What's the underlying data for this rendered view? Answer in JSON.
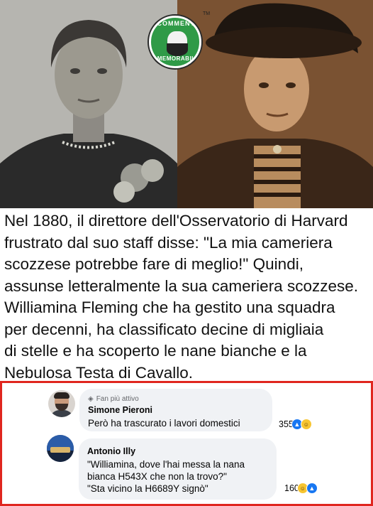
{
  "brand": {
    "badge_top": "COMMENTI",
    "badge_bottom": "MEMORABILI",
    "trademark": "TM",
    "color": "#2f9a47"
  },
  "caption": {
    "lines": [
      "Nel 1880, il direttore dell'Osservatorio di Harvard",
      "frustrato dal suo staff disse: \"La mia cameriera",
      "scozzese potrebbe fare di meglio!\" Quindi,",
      "assunse letteralmente la sua cameriera scozzese.",
      "Williamina Fleming che ha gestito una squadra",
      "per decenni, ha classificato decine di migliaia",
      "di stelle e ha scoperto le nane bianche e la",
      "Nebulosa Testa di Cavallo."
    ]
  },
  "comments": [
    {
      "badge": "Fan più attivo",
      "badge_icon": "shield-icon",
      "author": "Simone Pieroni",
      "text_lines": [
        "Però ha trascurato i lavori domestici"
      ],
      "reaction_count": "355",
      "reactions": [
        "like",
        "haha"
      ]
    },
    {
      "author": "Antonio Illy",
      "text_lines": [
        "\"Williamina, dove l'hai messa la nana",
        "bianca H543X che non la trovo?\"",
        "\"Sta vicino la H6689Y signò\""
      ],
      "reaction_count": "160",
      "reactions": [
        "haha",
        "like"
      ]
    }
  ],
  "colors": {
    "highlight_border": "#e0261f",
    "bubble_bg": "#f0f2f5",
    "like": "#1877f2",
    "haha": "#f7c531"
  }
}
